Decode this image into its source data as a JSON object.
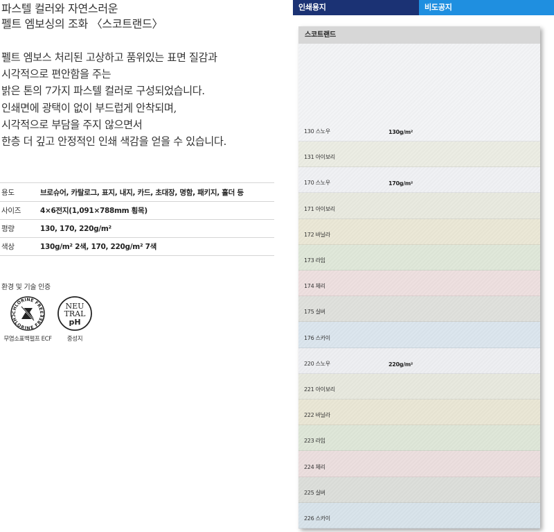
{
  "headline": [
    "파스텔 컬러와 자연스러운",
    "펠트 엠보싱의 조화 〈스코트랜드〉"
  ],
  "description": [
    "펠트 엠보스 처리된 고상하고 품위있는 표면 질감과",
    "시각적으로 편안함을 주는",
    "밝은 톤의 7가지 파스텔 컬러로 구성되었습니다.",
    "인쇄면에 광택이 없이 부드럽게 안착되며,",
    "시각적으로 부담을 주지 않으면서",
    "한층 더 깊고 안정적인 인쇄 색감을 얻을 수 있습니다."
  ],
  "specs": [
    {
      "label": "용도",
      "value": "브로슈어, 카탈로그, 표지, 내지, 카드, 초대장, 명함, 패키지, 홀더 등"
    },
    {
      "label": "사이즈",
      "value": "4×6전지(1,091×788mm 횡목)"
    },
    {
      "label": "평량",
      "value": "130, 170, 220g/m²"
    },
    {
      "label": "색상",
      "value": "130g/m² 2색, 170, 220g/m² 7색"
    }
  ],
  "certifications": {
    "title": "환경 및 기술 인증",
    "items": [
      {
        "icon": "chlorine-free-icon",
        "caption": "무염소표백펄프 ECF",
        "badge": "CHLORINE FREE"
      },
      {
        "icon": "neutral-ph-icon",
        "caption": "중성지",
        "badge_lines": [
          "NEU",
          "TRAL",
          "pH"
        ]
      }
    ]
  },
  "tabs": {
    "print_paper": "인쇄용지",
    "non_coated": "비도공지"
  },
  "sample": {
    "title": "스코트랜드",
    "swatches": [
      {
        "name": "130 스노우",
        "weight": "130g/m²",
        "color": "#f3f4f6"
      },
      {
        "name": "131 아이보리",
        "weight": "",
        "color": "#ecede3"
      },
      {
        "name": "170 스노우",
        "weight": "170g/m²",
        "color": "#f0f1f4"
      },
      {
        "name": "171 아이보리",
        "weight": "",
        "color": "#e9eadf"
      },
      {
        "name": "172 바닐라",
        "weight": "",
        "color": "#ebe8d6"
      },
      {
        "name": "173 라임",
        "weight": "",
        "color": "#dfe8d9"
      },
      {
        "name": "174 체리",
        "weight": "",
        "color": "#eedfdf"
      },
      {
        "name": "175 실버",
        "weight": "",
        "color": "#dfe0dc"
      },
      {
        "name": "176 스카이",
        "weight": "",
        "color": "#dbe6ee"
      },
      {
        "name": "220 스노우",
        "weight": "220g/m²",
        "color": "#eeeff2"
      },
      {
        "name": "221 아이보리",
        "weight": "",
        "color": "#e8e9de"
      },
      {
        "name": "222 바닐라",
        "weight": "",
        "color": "#eae7d5"
      },
      {
        "name": "223 라임",
        "weight": "",
        "color": "#dee7d8"
      },
      {
        "name": "224 체리",
        "weight": "",
        "color": "#ecdede"
      },
      {
        "name": "225 실버",
        "weight": "",
        "color": "#dcdeda"
      },
      {
        "name": "226 스카이",
        "weight": "",
        "color": "#d8e3eb"
      }
    ]
  }
}
